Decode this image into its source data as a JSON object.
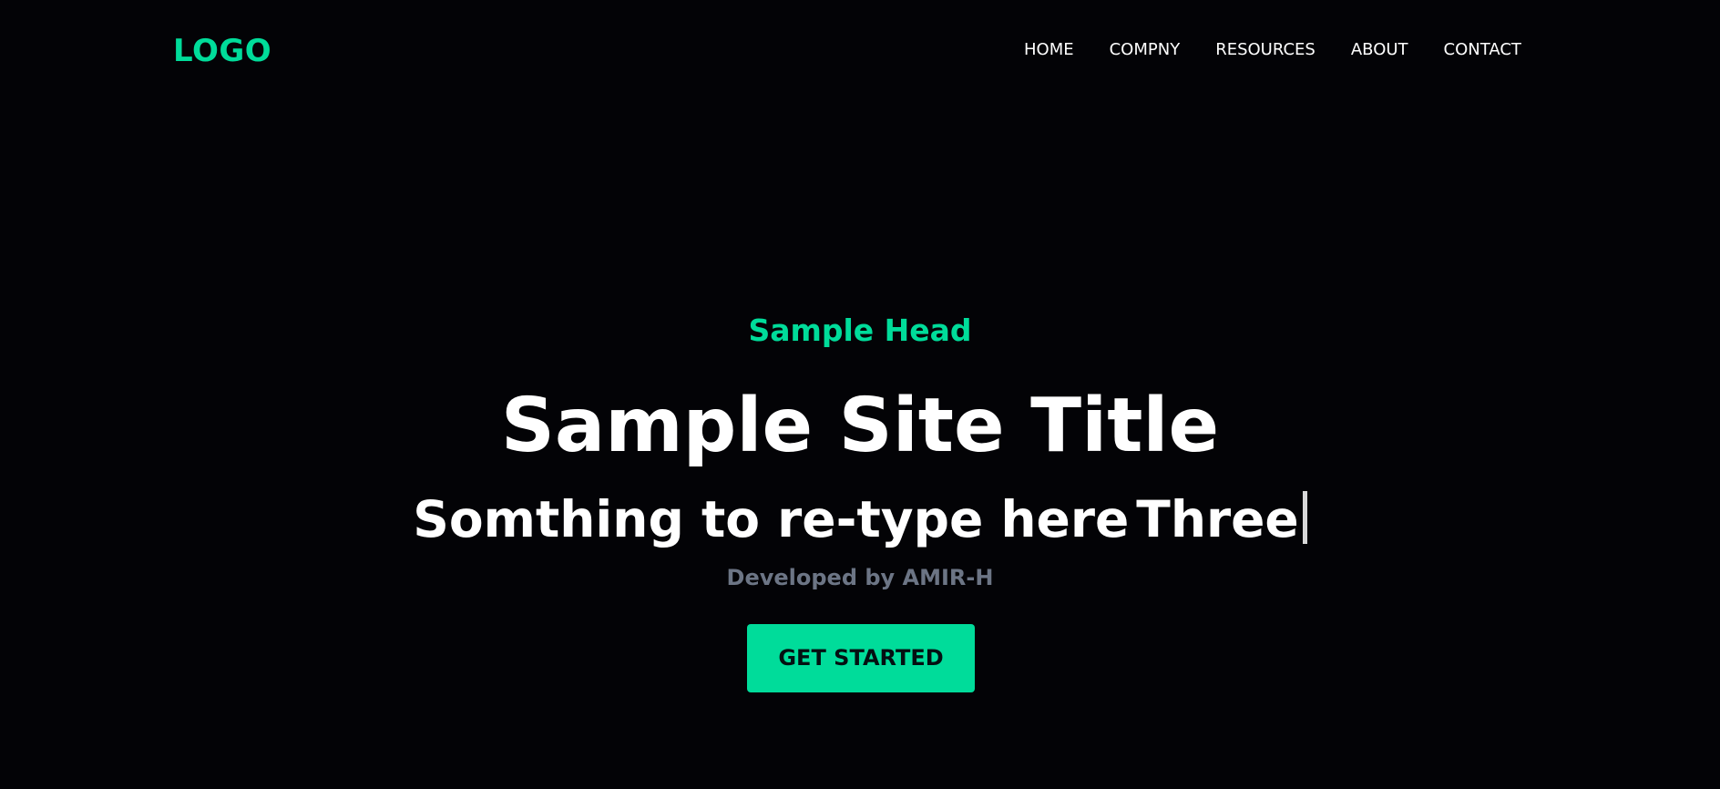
{
  "header": {
    "logo_text": "LOGO",
    "nav": {
      "items": [
        {
          "label": "HOME"
        },
        {
          "label": "COMPNY"
        },
        {
          "label": "RESOURCES"
        },
        {
          "label": "ABOUT"
        },
        {
          "label": "CONTACT"
        }
      ]
    }
  },
  "hero": {
    "head": "Sample Head",
    "title": "Sample Site Title",
    "typed_prefix": "Somthing to re-type here",
    "typed_word": "Three",
    "credit": "Developed by AMIR-H",
    "cta_label": "GET STARTED"
  },
  "theme": {
    "background": "#030306",
    "accent": "#00dc9a",
    "text": "#ffffff",
    "muted": "#6c7585"
  }
}
